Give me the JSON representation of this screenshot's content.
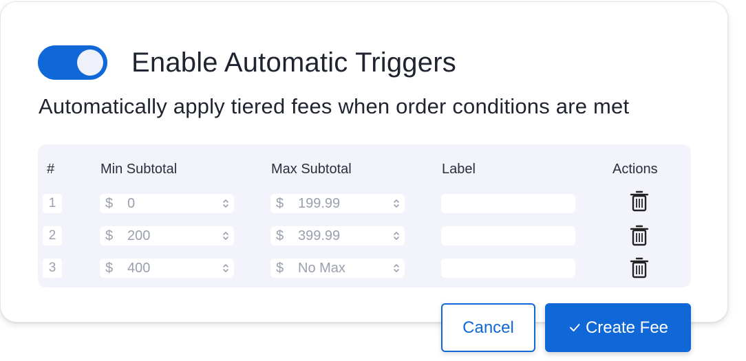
{
  "toggle": {
    "enabled": true
  },
  "title": "Enable Automatic Triggers",
  "subtitle": "Automatically apply tiered fees when order conditions are met",
  "table": {
    "headers": {
      "index": "#",
      "min": "Min Subtotal",
      "max": "Max Subtotal",
      "label": "Label",
      "actions": "Actions"
    },
    "rows": [
      {
        "num": "1",
        "currency_min": "$",
        "min": "0",
        "currency_max": "$",
        "max": "199.99",
        "label": ""
      },
      {
        "num": "2",
        "currency_min": "$",
        "min": "200",
        "currency_max": "$",
        "max": "399.99",
        "label": ""
      },
      {
        "num": "3",
        "currency_min": "$",
        "min": "400",
        "currency_max": "$",
        "max": "No Max",
        "label": ""
      }
    ]
  },
  "buttons": {
    "cancel": "Cancel",
    "create": "Create Fee"
  },
  "colors": {
    "accent": "#1068d8",
    "panel": "#f3f3fb",
    "muted_text": "#9aa0ad"
  },
  "icons": {
    "toggle": "toggle-switch-on",
    "spinner": "chevron-up-down-icon",
    "delete": "trash-icon",
    "confirm": "check-icon"
  }
}
